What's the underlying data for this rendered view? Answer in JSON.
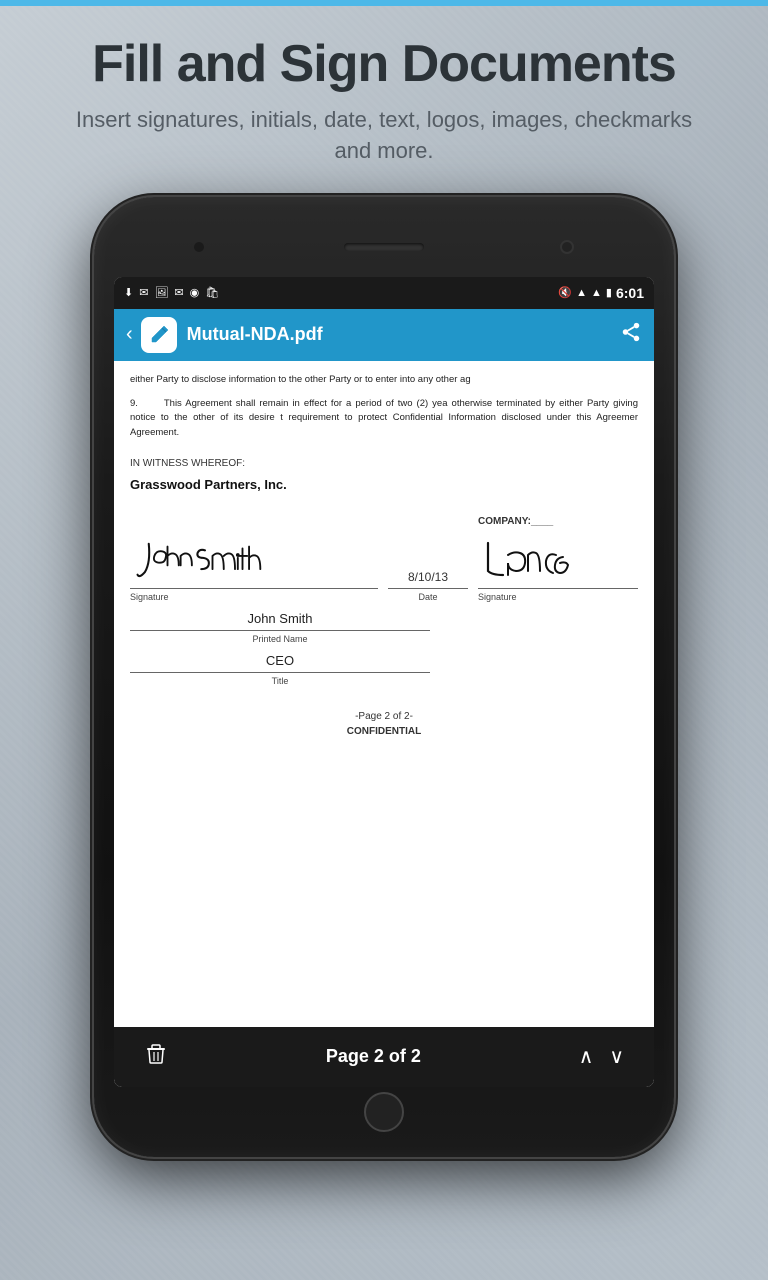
{
  "top_bar": {
    "color": "#4db8e8"
  },
  "header": {
    "title": "Fill and Sign Documents",
    "subtitle": "Insert signatures, initials, date, text, logos, images, checkmarks and more."
  },
  "phone": {
    "status_bar": {
      "time": "6:01",
      "icons_left": [
        "download",
        "mail",
        "image",
        "mail2",
        "camera",
        "bag"
      ],
      "icons_right": [
        "mute",
        "wifi",
        "signal",
        "battery"
      ]
    },
    "toolbar": {
      "back_label": "‹",
      "app_icon": "✏️",
      "title": "Mutual-NDA.pdf",
      "share_icon": "share"
    },
    "document": {
      "paragraph_8_text": "either Party to disclose information to the other Party or to enter into any other ag",
      "paragraph_9_num": "9.",
      "paragraph_9_text": "This Agreement shall remain in effect for a period of two (2) yea otherwise terminated by either Party giving notice to the other of its desire t requirement to protect Confidential Information disclosed under this Agreemer Agreement.",
      "witness_label": "IN WITNESS WHEREOF:",
      "company_name": "Grasswood Partners, Inc.",
      "company_right_label": "COMPANY:____",
      "signature_label": "Signature",
      "date_label": "Date",
      "date_value": "8/10/13",
      "printed_name_value": "John Smith",
      "printed_name_label": "Printed Name",
      "title_value": "CEO",
      "title_label": "Title",
      "page_footer": "-Page 2 of 2-",
      "confidential_label": "CONFIDENTIAL"
    },
    "bottom_bar": {
      "page_info": "Page 2 of 2",
      "trash_icon": "trash",
      "up_arrow": "∧",
      "down_arrow": "∨"
    }
  }
}
